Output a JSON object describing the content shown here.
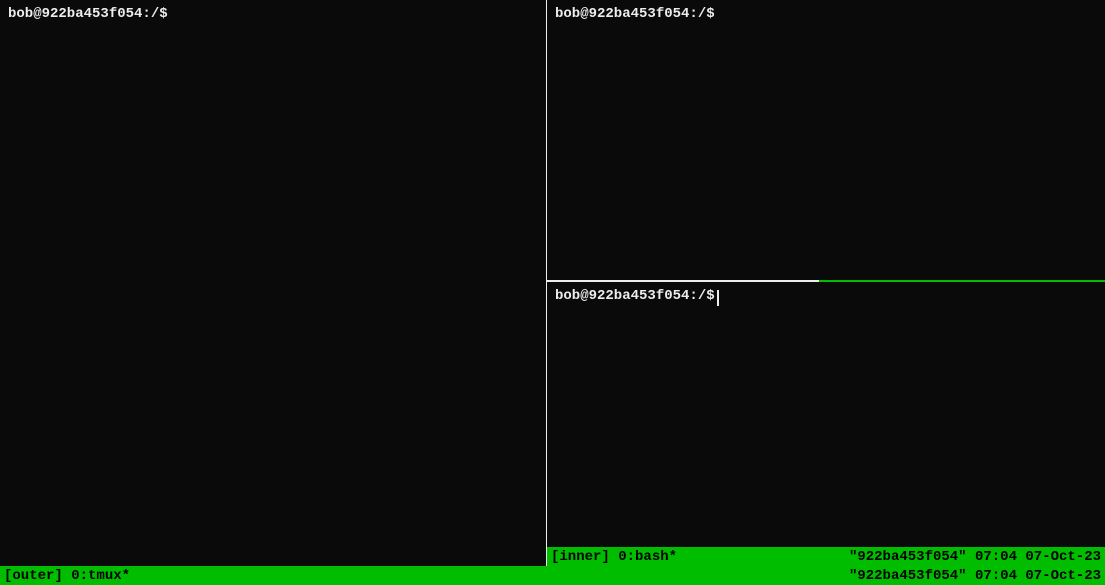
{
  "panes": {
    "left": {
      "prompt": "bob@922ba453f054:/$"
    },
    "rightTop": {
      "prompt": "bob@922ba453f054:/$"
    },
    "rightBottom": {
      "prompt": "bob@922ba453f054:/$"
    }
  },
  "innerStatus": {
    "left": "[inner] 0:bash*",
    "right": "\"922ba453f054\" 07:04 07-Oct-23"
  },
  "outerStatus": {
    "left": "[outer] 0:tmux*",
    "right": "\"922ba453f054\" 07:04 07-Oct-23"
  }
}
